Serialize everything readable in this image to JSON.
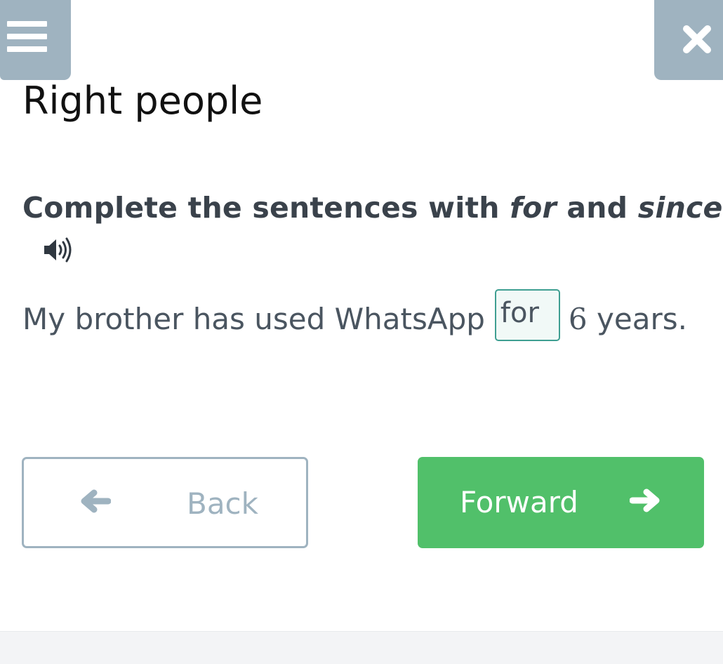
{
  "header": {
    "menu_icon": "hamburger-menu-icon",
    "close_icon": "close-icon"
  },
  "page": {
    "title": "Right people"
  },
  "task": {
    "instruction_part1": "Complete the sentences with ",
    "keyword1": "for",
    "instruction_part2": " and ",
    "keyword2": "since",
    "instruction_end": ".",
    "audio_icon": "speaker-icon"
  },
  "exercise": {
    "sentence_before": "My brother has used WhatsApp",
    "answer_value": "for",
    "number": "6",
    "sentence_after": " years."
  },
  "navigation": {
    "back_label": "Back",
    "forward_label": "Forward",
    "back_icon": "arrow-left-icon",
    "forward_icon": "arrow-right-icon"
  },
  "colors": {
    "accent_gray": "#9fb3c0",
    "forward_green": "#51c06a",
    "answer_border": "#3f9f92"
  }
}
